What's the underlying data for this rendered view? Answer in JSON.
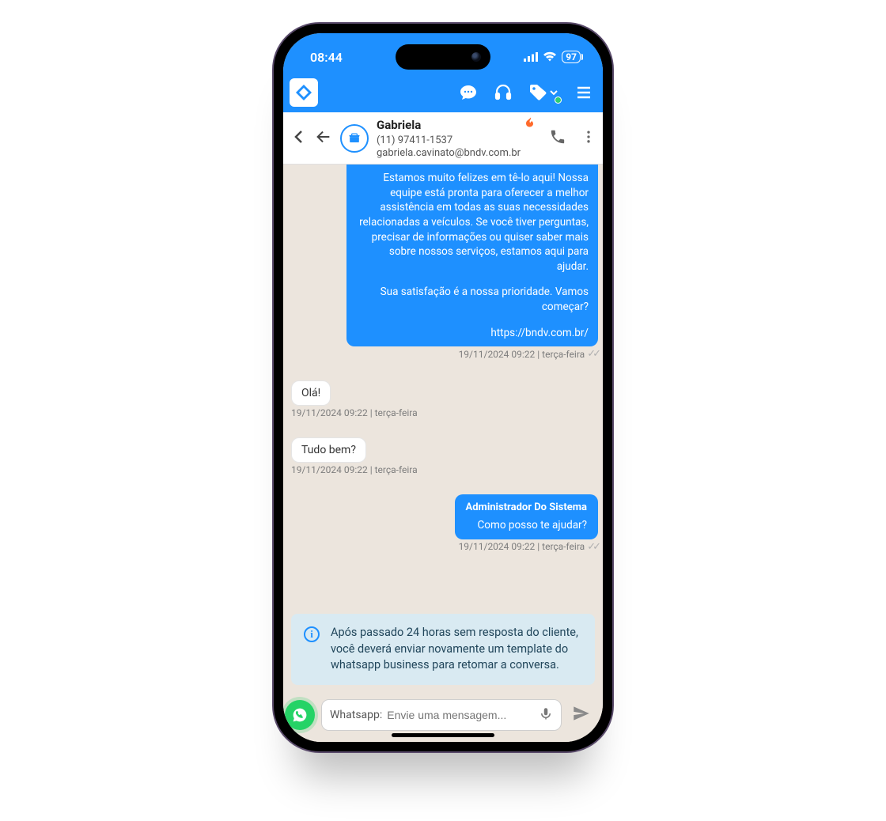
{
  "status": {
    "time": "08:44",
    "battery": "97"
  },
  "contact": {
    "name": "Gabriela",
    "phone": "(11) 97411-1537",
    "email": "gabriela.cavinato@bndv.com.br"
  },
  "messages": {
    "intro": {
      "body": "Estamos muito felizes em tê-lo aqui! Nossa equipe está pronta para oferecer a melhor assistência em todas as suas necessidades relacionadas a veículos. Se você tiver perguntas, precisar de informações ou quiser saber mais sobre nossos serviços, estamos aqui para ajudar.",
      "line2": "Sua satisfação é a nossa prioridade. Vamos começar?",
      "link": "https://bndv.com.br/",
      "ts": "19/11/2024 09:22 | terça-feira"
    },
    "in1": {
      "text": "Olá!",
      "ts": "19/11/2024 09:22 | terça-feira"
    },
    "in2": {
      "text": "Tudo bem?",
      "ts": "19/11/2024 09:22 | terça-feira"
    },
    "out2": {
      "sender": "Administrador Do Sistema",
      "text": "Como posso te ajudar?",
      "ts": "19/11/2024 09:22 | terça-feira"
    }
  },
  "notice": "Após passado 24 horas sem resposta do cliente, você deverá enviar novamente um template do whatsapp business para retomar a conversa.",
  "input": {
    "prefix": "Whatsapp:",
    "placeholder": "Envie uma mensagem..."
  }
}
